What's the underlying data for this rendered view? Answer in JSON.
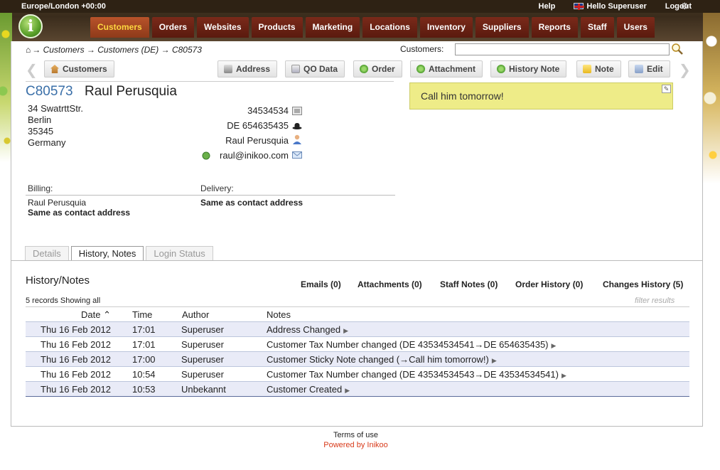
{
  "header": {
    "timezone": "Europe/London +00:00",
    "help": "Help",
    "user": "Hello Superuser",
    "logout": "Logout"
  },
  "nav": {
    "tabs": [
      "Customers",
      "Orders",
      "Websites",
      "Products",
      "Marketing",
      "Locations",
      "Inventory",
      "Suppliers",
      "Reports",
      "Staff",
      "Users"
    ],
    "active": "Customers"
  },
  "breadcrumb": {
    "home_glyph": "⌂",
    "path": "→ Customers → Customers (DE) → C80573"
  },
  "search": {
    "label": "Customers:",
    "value": ""
  },
  "toolbar": {
    "customers": "Customers",
    "address": "Address",
    "qo_data": "QO Data",
    "order": "Order",
    "attachment": "Attachment",
    "history_note": "History Note",
    "note": "Note",
    "edit": "Edit"
  },
  "customer": {
    "id": "C80573",
    "name": "Raul Perusquia",
    "address": [
      "34 SwatrttStr.",
      "Berlin",
      "35345",
      "Germany"
    ],
    "phone": "34534534",
    "tax": "DE 654635435",
    "contact": "Raul Perusquia",
    "email": "raul@inikoo.com"
  },
  "sticky_note": "Call him tomorrow!",
  "billing": {
    "label": "Billing:",
    "name": "Raul Perusquia",
    "same": "Same as contact address"
  },
  "delivery": {
    "label": "Delivery:",
    "same": "Same as contact address"
  },
  "tabs": {
    "details": "Details",
    "history": "History, Notes",
    "login": "Login Status",
    "active": "history"
  },
  "history": {
    "title": "History/Notes",
    "links": {
      "emails": "Emails (0)",
      "attachments": "Attachments (0)",
      "staff_notes": "Staff Notes (0)",
      "order_history": "Order History (0)",
      "changes_history": "Changes History (5)"
    },
    "records": "5 records Showing all",
    "filter_placeholder": "filter results",
    "columns": {
      "date": "Date ⌃",
      "time": "Time",
      "author": "Author",
      "notes": "Notes"
    },
    "rows": [
      {
        "date": "Thu 16 Feb 2012",
        "time": "17:01",
        "author": "Superuser",
        "notes": "Address Changed"
      },
      {
        "date": "Thu 16 Feb 2012",
        "time": "17:01",
        "author": "Superuser",
        "notes": "Customer Tax Number changed (DE 43534534541→DE 654635435)"
      },
      {
        "date": "Thu 16 Feb 2012",
        "time": "17:00",
        "author": "Superuser",
        "notes": "Customer Sticky Note changed (→Call him tomorrow!)"
      },
      {
        "date": "Thu 16 Feb 2012",
        "time": "10:54",
        "author": "Superuser",
        "notes": "Customer Tax Number changed (DE 43534534543→DE 43534534541)"
      },
      {
        "date": "Thu 16 Feb 2012",
        "time": "10:53",
        "author": "Unbekannt",
        "notes": "Customer Created"
      }
    ]
  },
  "footer": {
    "terms": "Terms of use",
    "powered": "Powered by Inikoo"
  },
  "colors": {
    "accent": "#3a6fa8",
    "nav_active_text": "#ffd840",
    "sticky_bg": "#eeec88",
    "row_alt": "#e9ebf7",
    "footer_link": "#d83a1a"
  }
}
